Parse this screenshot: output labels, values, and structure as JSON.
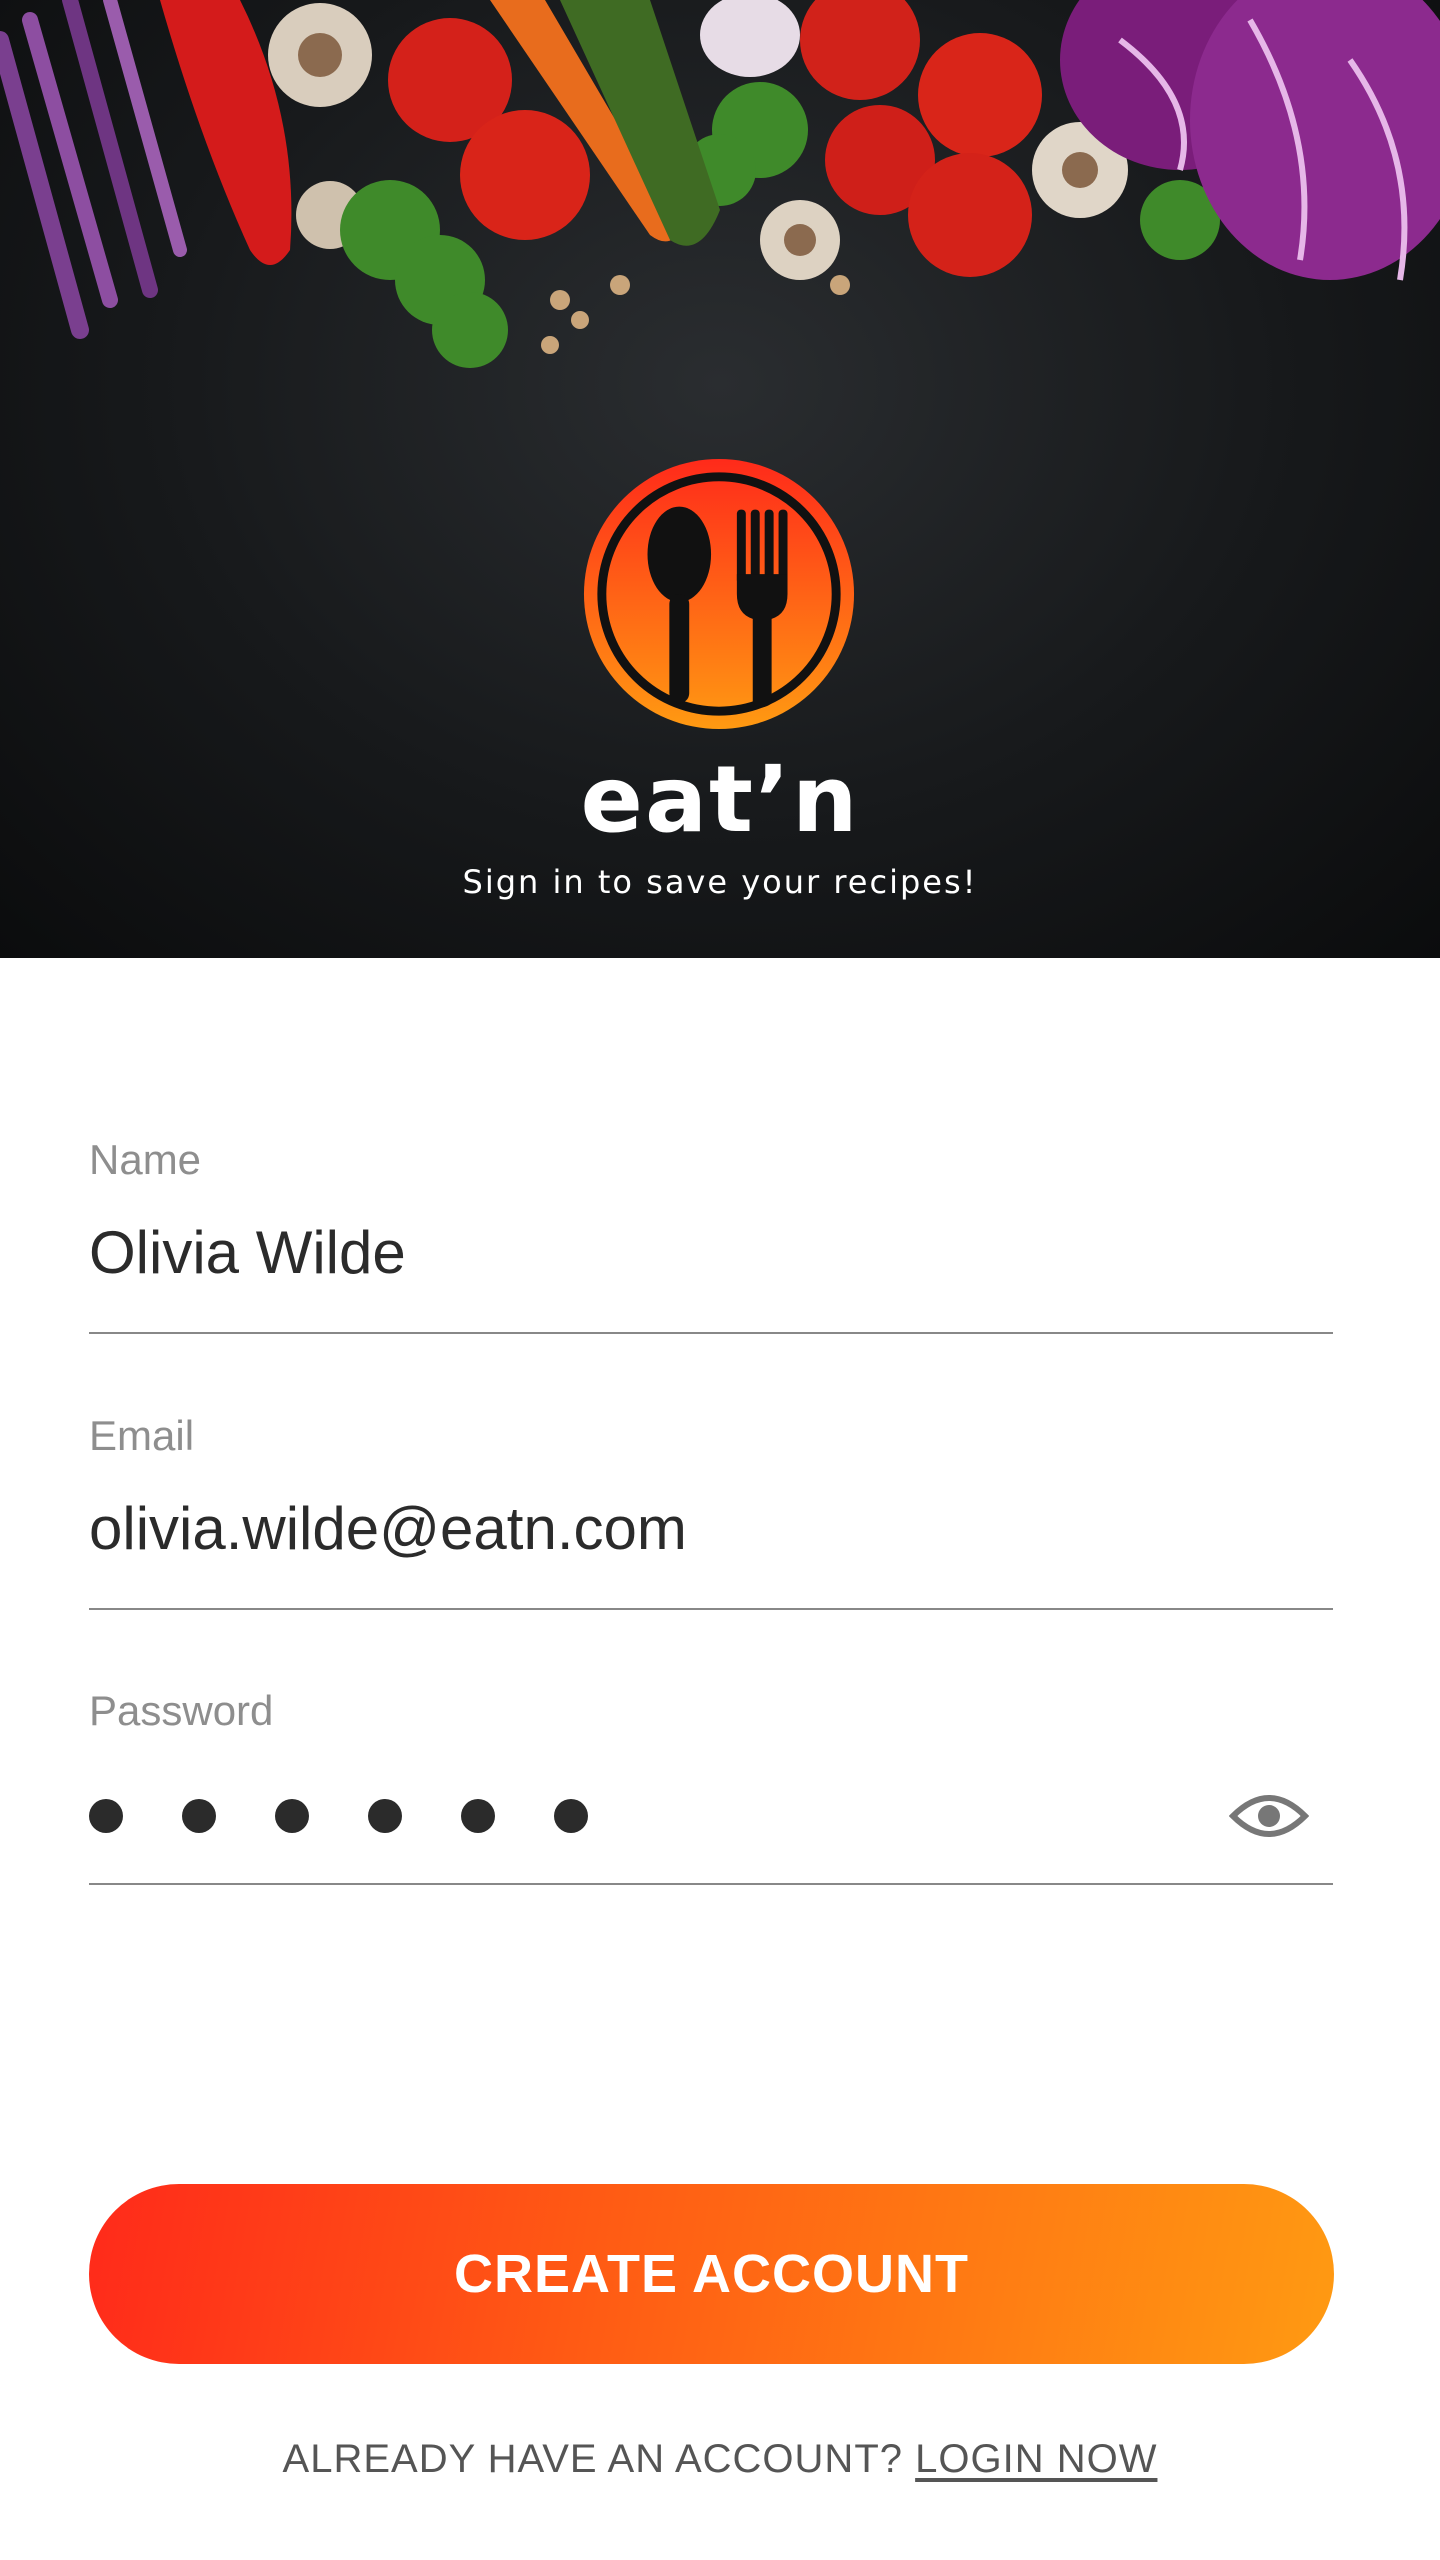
{
  "hero": {
    "brand": "eat’n",
    "tagline": "Sign in to save your recipes!",
    "logo_colors": [
      "#ff2a1a",
      "#ff9a12"
    ]
  },
  "form": {
    "name": {
      "label": "Name",
      "value": "Olivia Wilde"
    },
    "email": {
      "label": "Email",
      "value": "olivia.wilde@eatn.com"
    },
    "password": {
      "label": "Password",
      "masked_length": 6,
      "toggle_icon": "eye-icon"
    }
  },
  "actions": {
    "create_account_label": "CREATE ACCOUNT",
    "already_have_account": "ALREADY HAVE AN ACCOUNT?",
    "login_now": "LOGIN NOW"
  },
  "colors": {
    "accent_start": "#ff2a1a",
    "accent_end": "#ff9a12",
    "label_gray": "#8e8e8e",
    "value_dark": "#2b2b2b"
  }
}
